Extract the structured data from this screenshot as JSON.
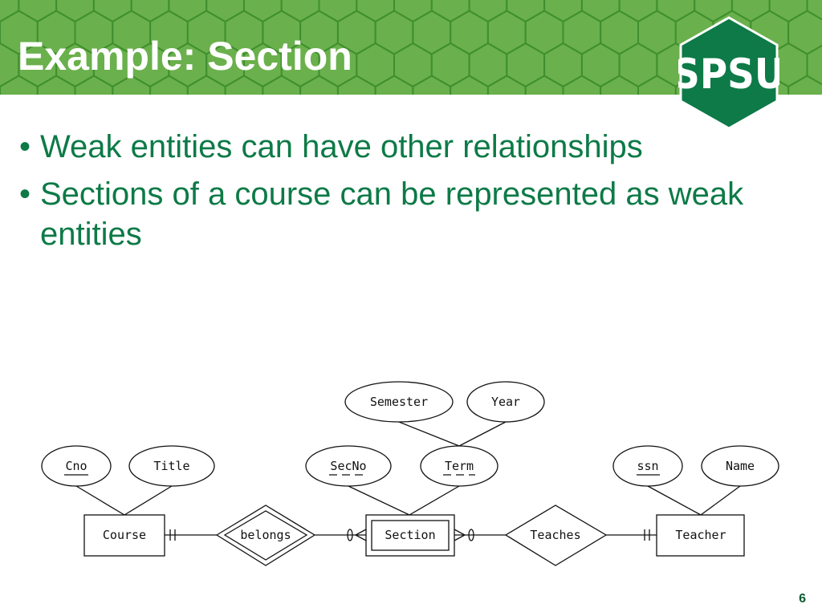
{
  "slide": {
    "title": "Example: Section",
    "logo_text": "SPSU",
    "bullets": [
      "Weak entities can have other relationships",
      "Sections of a course can be represented as weak entities"
    ],
    "page_number": "6"
  },
  "diagram": {
    "entities": {
      "course": "Course",
      "section": "Section",
      "teacher": "Teacher"
    },
    "relationships": {
      "belongs": "belongs",
      "teaches": "Teaches"
    },
    "attributes": {
      "cno": "Cno",
      "title": "Title",
      "secno": "SecNo",
      "term": "Term",
      "semester": "Semester",
      "year": "Year",
      "ssn": "ssn",
      "name": "Name"
    }
  },
  "colors": {
    "banner": "#6ab04c",
    "hex_lines": "#3f8f2e",
    "logo": "#0d7a47",
    "bullet_text": "#0d7a47"
  }
}
